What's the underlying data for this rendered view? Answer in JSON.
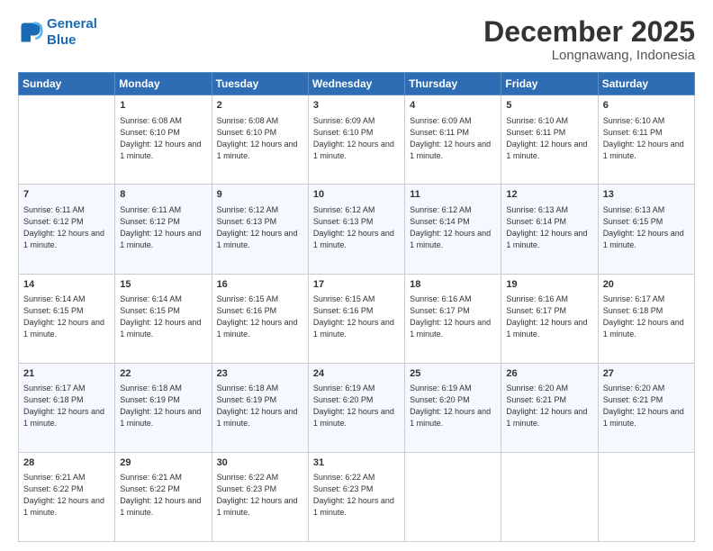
{
  "header": {
    "logo_line1": "General",
    "logo_line2": "Blue",
    "month": "December 2025",
    "location": "Longnawang, Indonesia"
  },
  "days_of_week": [
    "Sunday",
    "Monday",
    "Tuesday",
    "Wednesday",
    "Thursday",
    "Friday",
    "Saturday"
  ],
  "weeks": [
    [
      {
        "day": "",
        "info": ""
      },
      {
        "day": "1",
        "info": "Sunrise: 6:08 AM\nSunset: 6:10 PM\nDaylight: 12 hours and 1 minute."
      },
      {
        "day": "2",
        "info": "Sunrise: 6:08 AM\nSunset: 6:10 PM\nDaylight: 12 hours and 1 minute."
      },
      {
        "day": "3",
        "info": "Sunrise: 6:09 AM\nSunset: 6:10 PM\nDaylight: 12 hours and 1 minute."
      },
      {
        "day": "4",
        "info": "Sunrise: 6:09 AM\nSunset: 6:11 PM\nDaylight: 12 hours and 1 minute."
      },
      {
        "day": "5",
        "info": "Sunrise: 6:10 AM\nSunset: 6:11 PM\nDaylight: 12 hours and 1 minute."
      },
      {
        "day": "6",
        "info": "Sunrise: 6:10 AM\nSunset: 6:11 PM\nDaylight: 12 hours and 1 minute."
      }
    ],
    [
      {
        "day": "7",
        "info": "Sunrise: 6:11 AM\nSunset: 6:12 PM\nDaylight: 12 hours and 1 minute."
      },
      {
        "day": "8",
        "info": "Sunrise: 6:11 AM\nSunset: 6:12 PM\nDaylight: 12 hours and 1 minute."
      },
      {
        "day": "9",
        "info": "Sunrise: 6:12 AM\nSunset: 6:13 PM\nDaylight: 12 hours and 1 minute."
      },
      {
        "day": "10",
        "info": "Sunrise: 6:12 AM\nSunset: 6:13 PM\nDaylight: 12 hours and 1 minute."
      },
      {
        "day": "11",
        "info": "Sunrise: 6:12 AM\nSunset: 6:14 PM\nDaylight: 12 hours and 1 minute."
      },
      {
        "day": "12",
        "info": "Sunrise: 6:13 AM\nSunset: 6:14 PM\nDaylight: 12 hours and 1 minute."
      },
      {
        "day": "13",
        "info": "Sunrise: 6:13 AM\nSunset: 6:15 PM\nDaylight: 12 hours and 1 minute."
      }
    ],
    [
      {
        "day": "14",
        "info": "Sunrise: 6:14 AM\nSunset: 6:15 PM\nDaylight: 12 hours and 1 minute."
      },
      {
        "day": "15",
        "info": "Sunrise: 6:14 AM\nSunset: 6:15 PM\nDaylight: 12 hours and 1 minute."
      },
      {
        "day": "16",
        "info": "Sunrise: 6:15 AM\nSunset: 6:16 PM\nDaylight: 12 hours and 1 minute."
      },
      {
        "day": "17",
        "info": "Sunrise: 6:15 AM\nSunset: 6:16 PM\nDaylight: 12 hours and 1 minute."
      },
      {
        "day": "18",
        "info": "Sunrise: 6:16 AM\nSunset: 6:17 PM\nDaylight: 12 hours and 1 minute."
      },
      {
        "day": "19",
        "info": "Sunrise: 6:16 AM\nSunset: 6:17 PM\nDaylight: 12 hours and 1 minute."
      },
      {
        "day": "20",
        "info": "Sunrise: 6:17 AM\nSunset: 6:18 PM\nDaylight: 12 hours and 1 minute."
      }
    ],
    [
      {
        "day": "21",
        "info": "Sunrise: 6:17 AM\nSunset: 6:18 PM\nDaylight: 12 hours and 1 minute."
      },
      {
        "day": "22",
        "info": "Sunrise: 6:18 AM\nSunset: 6:19 PM\nDaylight: 12 hours and 1 minute."
      },
      {
        "day": "23",
        "info": "Sunrise: 6:18 AM\nSunset: 6:19 PM\nDaylight: 12 hours and 1 minute."
      },
      {
        "day": "24",
        "info": "Sunrise: 6:19 AM\nSunset: 6:20 PM\nDaylight: 12 hours and 1 minute."
      },
      {
        "day": "25",
        "info": "Sunrise: 6:19 AM\nSunset: 6:20 PM\nDaylight: 12 hours and 1 minute."
      },
      {
        "day": "26",
        "info": "Sunrise: 6:20 AM\nSunset: 6:21 PM\nDaylight: 12 hours and 1 minute."
      },
      {
        "day": "27",
        "info": "Sunrise: 6:20 AM\nSunset: 6:21 PM\nDaylight: 12 hours and 1 minute."
      }
    ],
    [
      {
        "day": "28",
        "info": "Sunrise: 6:21 AM\nSunset: 6:22 PM\nDaylight: 12 hours and 1 minute."
      },
      {
        "day": "29",
        "info": "Sunrise: 6:21 AM\nSunset: 6:22 PM\nDaylight: 12 hours and 1 minute."
      },
      {
        "day": "30",
        "info": "Sunrise: 6:22 AM\nSunset: 6:23 PM\nDaylight: 12 hours and 1 minute."
      },
      {
        "day": "31",
        "info": "Sunrise: 6:22 AM\nSunset: 6:23 PM\nDaylight: 12 hours and 1 minute."
      },
      {
        "day": "",
        "info": ""
      },
      {
        "day": "",
        "info": ""
      },
      {
        "day": "",
        "info": ""
      }
    ]
  ]
}
